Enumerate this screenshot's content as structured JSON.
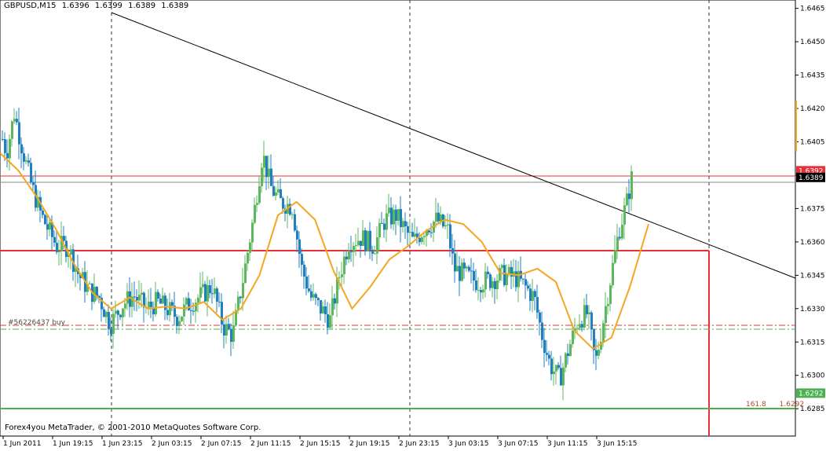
{
  "header": {
    "symbol": "GBPUSD,M15",
    "open": "1.6396",
    "high": "1.6399",
    "low": "1.6389",
    "close": "1.6389"
  },
  "copyright": "Forex4you MetaTrader, © 2001-2010 MetaQuotes Software Corp.",
  "order_label": "#56226437 buy",
  "fib": {
    "level": "161.8",
    "price": "1.6292"
  },
  "colors": {
    "background": "#ffffff",
    "bull": "#5cb85c",
    "bear": "#1f7fbf",
    "ma": "#f5a623",
    "trendline": "#000000",
    "resistance": "#e8303a",
    "support": "#4caf50",
    "current_price": "#000000"
  },
  "chart_data": {
    "type": "candlestick",
    "symbol": "GBPUSD",
    "timeframe": "M15",
    "ylim": [
      1.6278,
      1.6467
    ],
    "y_ticks": [
      "1.6465",
      "1.6450",
      "1.6435",
      "1.6420",
      "1.6405",
      "1.6390",
      "1.6375",
      "1.6360",
      "1.6345",
      "1.6330",
      "1.6315",
      "1.6300",
      "1.6285"
    ],
    "x_ticks": [
      "1 Jun 2011",
      "1 Jun 19:15",
      "1 Jun 23:15",
      "2 Jun 03:15",
      "2 Jun 07:15",
      "2 Jun 11:15",
      "2 Jun 15:15",
      "2 Jun 19:15",
      "2 Jun 23:15",
      "3 Jun 03:15",
      "3 Jun 07:15",
      "3 Jun 11:15",
      "3 Jun 15:15"
    ],
    "price_markers": [
      {
        "label": "1.6392",
        "value": 1.6392,
        "color": "#e8303a"
      },
      {
        "label": "1.6389",
        "value": 1.6389,
        "color": "#000000"
      },
      {
        "label": "1.6292",
        "value": 1.6292,
        "color": "#4caf50"
      }
    ],
    "lines": [
      {
        "name": "resistance",
        "value": 1.6392
      },
      {
        "name": "current",
        "value": 1.6389
      },
      {
        "name": "range-top",
        "value": 1.636
      },
      {
        "name": "order-red",
        "value": 1.6327
      },
      {
        "name": "order-green",
        "value": 1.6326
      },
      {
        "name": "range-bottom",
        "value": 1.6293
      }
    ],
    "ma_sample": [
      1.64,
      1.6392,
      1.638,
      1.6366,
      1.635,
      1.6337,
      1.633,
      1.6335,
      1.633,
      1.6331,
      1.633,
      1.6333,
      1.6325,
      1.633,
      1.6345,
      1.6372,
      1.6378,
      1.637,
      1.6347,
      1.633,
      1.634,
      1.6352,
      1.6358,
      1.6365,
      1.637,
      1.6368,
      1.636,
      1.6346,
      1.6345,
      1.6348,
      1.6342,
      1.632,
      1.6312,
      1.6317,
      1.634,
      1.6368
    ],
    "candles_summary": {
      "first_close": 1.6396,
      "period_high": 1.6426,
      "period_low": 1.6288,
      "last_close": 1.6389
    }
  }
}
